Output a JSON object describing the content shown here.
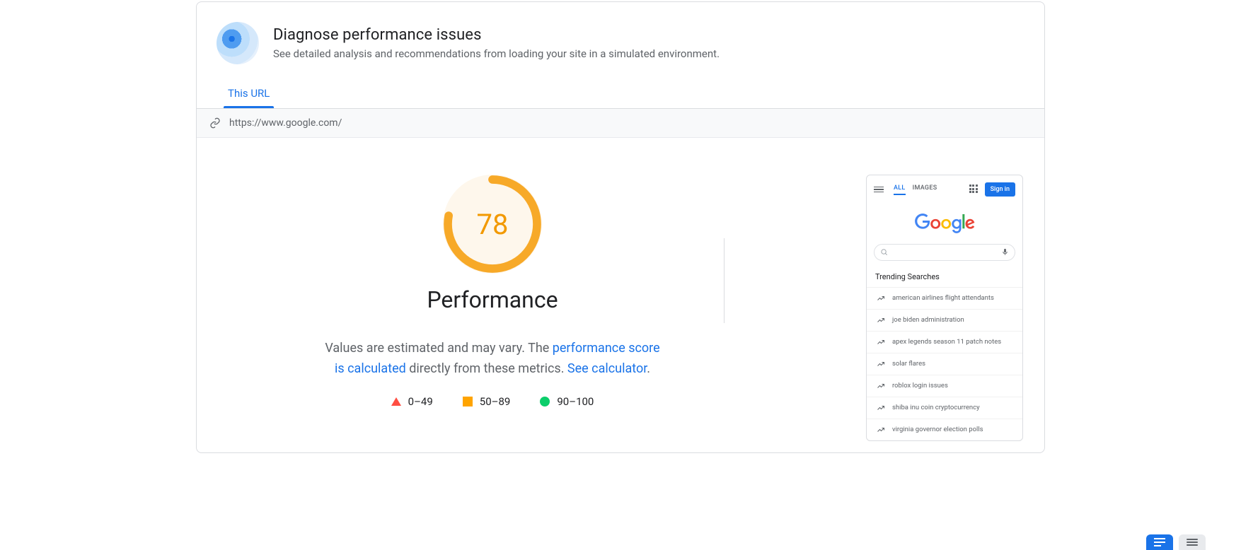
{
  "header": {
    "title": "Diagnose performance issues",
    "subtitle": "See detailed analysis and recommendations from loading your site in a simulated environment."
  },
  "tabs": {
    "active": "This URL"
  },
  "url": "https://www.google.com/",
  "performance": {
    "score": "78",
    "title": "Performance",
    "desc_part1": "Values are estimated and may vary. The ",
    "link1": "performance score is calculated",
    "desc_part2": " directly from these metrics. ",
    "link2": "See calculator",
    "period": "."
  },
  "legend": {
    "bad": "0–49",
    "mid": "50–89",
    "good": "90–100"
  },
  "preview": {
    "tab_all": "ALL",
    "tab_images": "IMAGES",
    "signin": "Sign in",
    "trending_title": "Trending Searches",
    "trends": [
      "american airlines flight attendants",
      "joe biden administration",
      "apex legends season 11 patch notes",
      "solar flares",
      "roblox login issues",
      "shiba inu coin cryptocurrency",
      "virginia governor election polls"
    ]
  }
}
